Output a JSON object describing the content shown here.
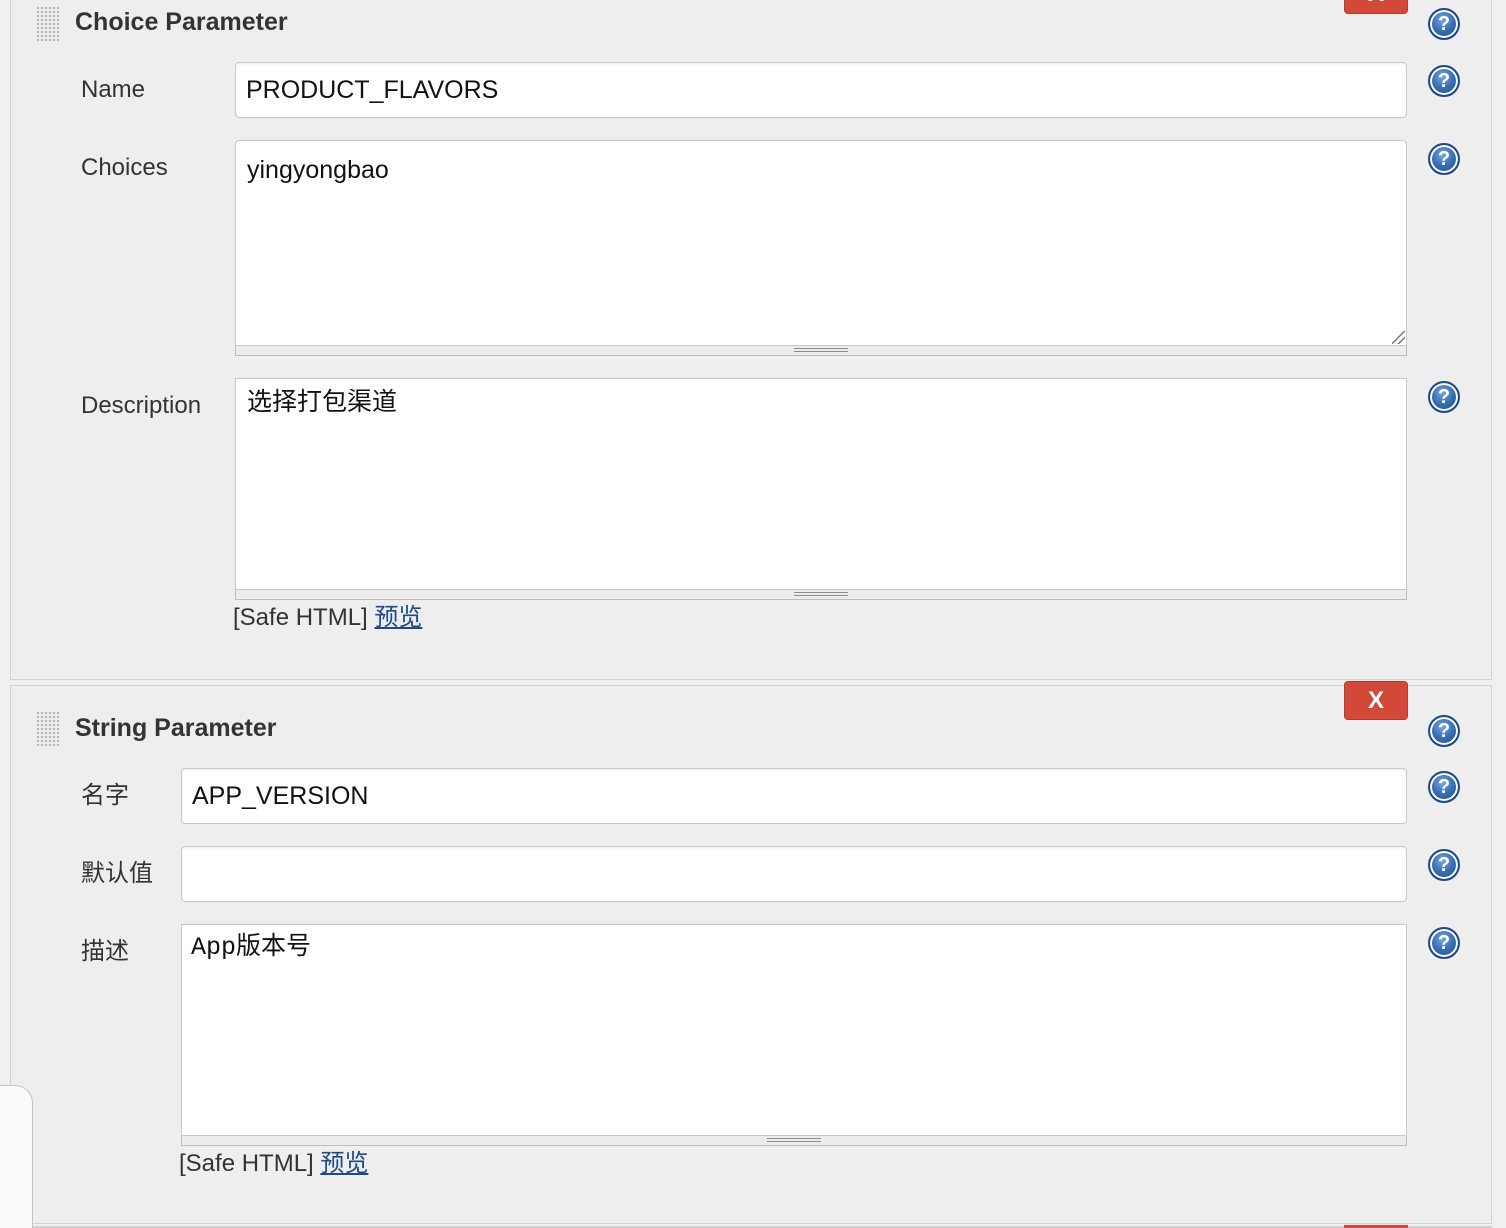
{
  "panels": {
    "choice": {
      "title": "Choice Parameter",
      "delete_label": "X",
      "name_label": "Name",
      "name_value": "PRODUCT_FLAVORS",
      "choices_label": "Choices",
      "choices_value": "yingyongbao",
      "description_label": "Description",
      "description_value": "选择打包渠道",
      "safe_html": "[Safe HTML]",
      "preview_link": "预览"
    },
    "string": {
      "title": "String Parameter",
      "delete_label": "X",
      "name_label": "名字",
      "name_value": "APP_VERSION",
      "default_label": "默认值",
      "default_value": "",
      "description_label": "描述",
      "description_value": "App版本号",
      "safe_html": "[Safe HTML]",
      "preview_link": "预览"
    }
  },
  "icons": {
    "help": {
      "name": "help-icon",
      "glyph": "?"
    },
    "drag": "drag-handle-icon",
    "resize": "resize-grip-icon"
  },
  "colors": {
    "delete_button": "#d24939",
    "link": "#204a87",
    "help_icon": "#3a6fb3",
    "panel_background": "#eeeeee"
  }
}
